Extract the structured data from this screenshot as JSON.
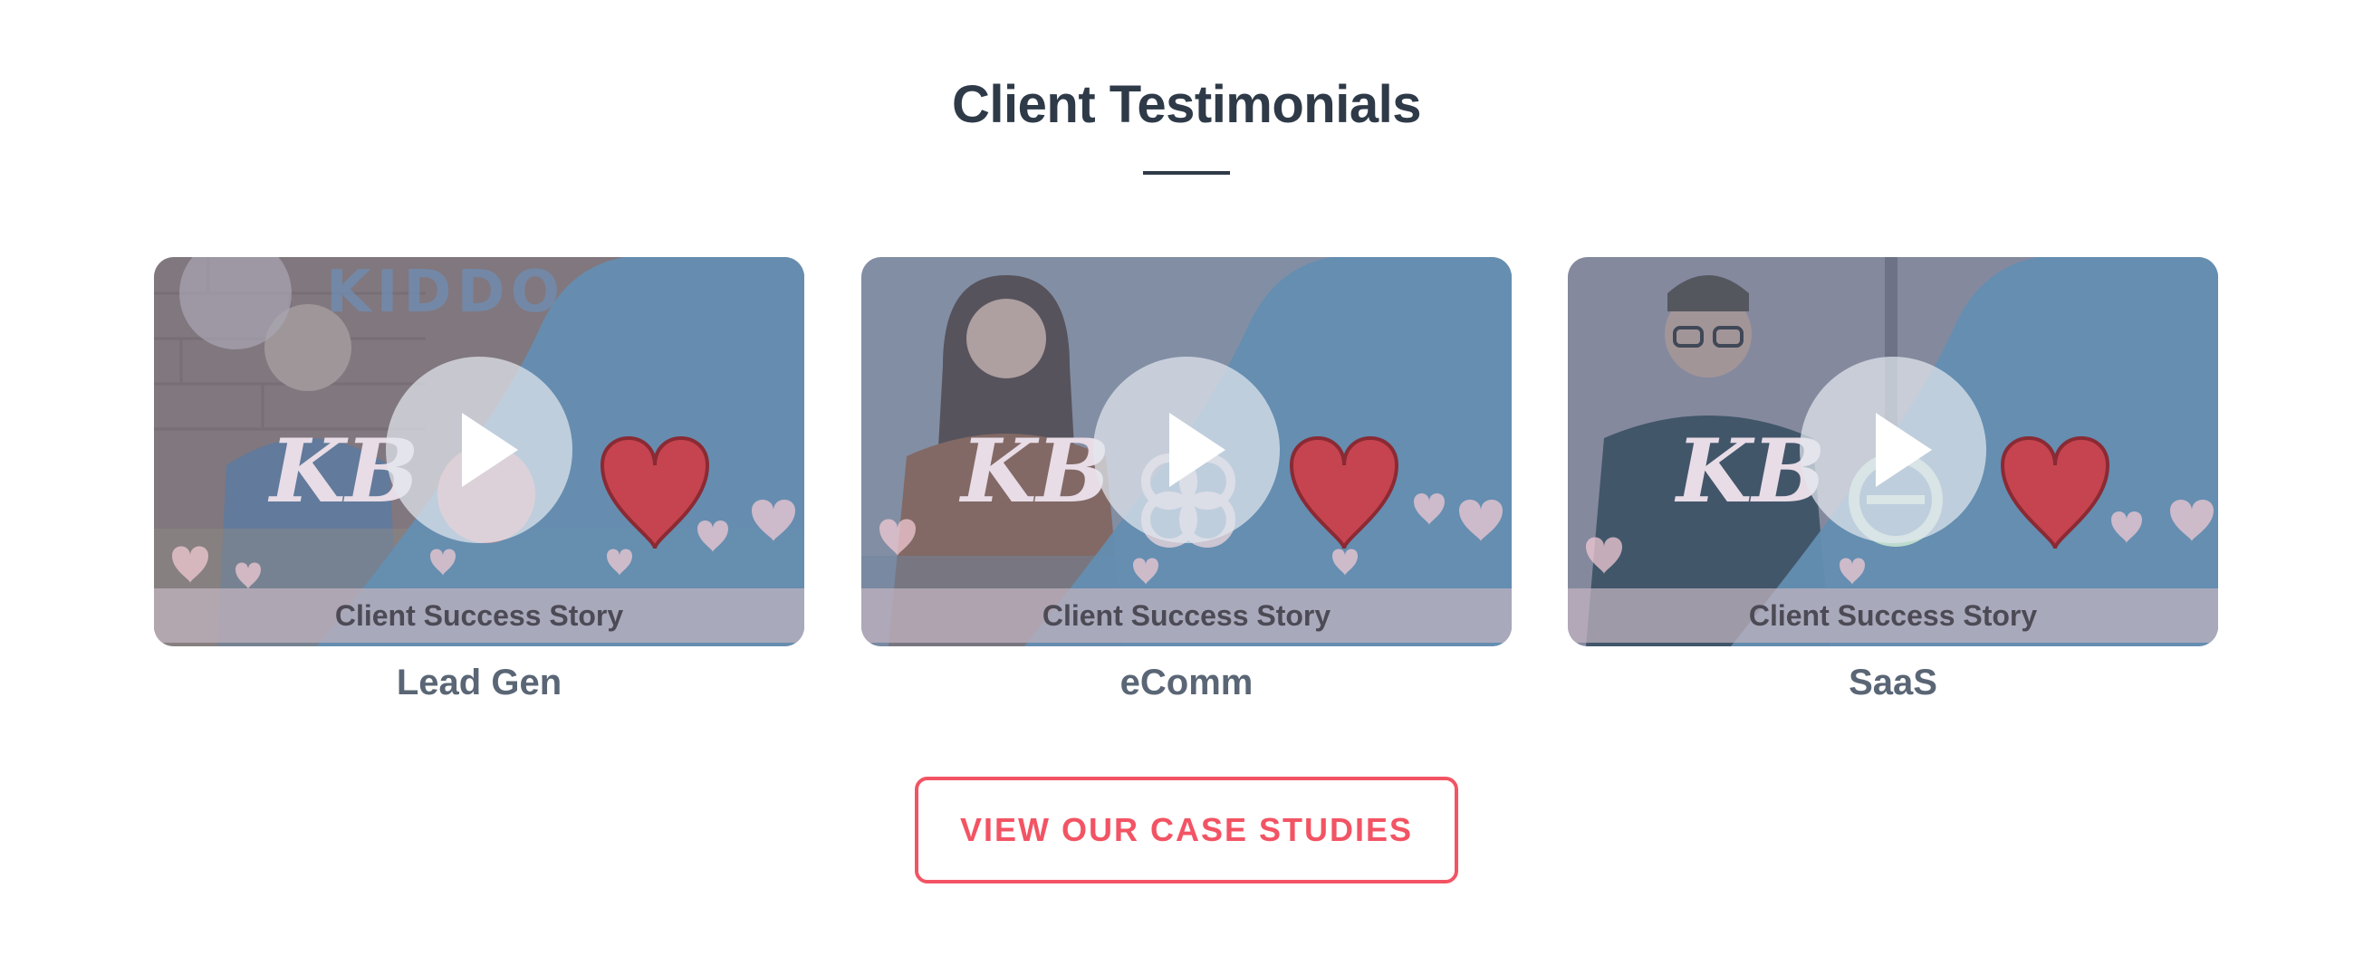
{
  "section": {
    "title": "Client Testimonials"
  },
  "cards": [
    {
      "caption": "Client Success Story",
      "label": "Lead Gen",
      "thumbnail_text": "KIDDO"
    },
    {
      "caption": "Client Success Story",
      "label": "eComm"
    },
    {
      "caption": "Client Success Story",
      "label": "SaaS"
    }
  ],
  "cta": {
    "label": "VIEW OUR CASE STUDIES"
  },
  "colors": {
    "heading": "#2f3a48",
    "accent": "#f25464",
    "card_label": "#5a6675",
    "overlay_blue": "#5f8fb0",
    "heart": "#c6444f"
  },
  "icons": [
    "play-icon",
    "heart-icon",
    "kb-logo"
  ]
}
